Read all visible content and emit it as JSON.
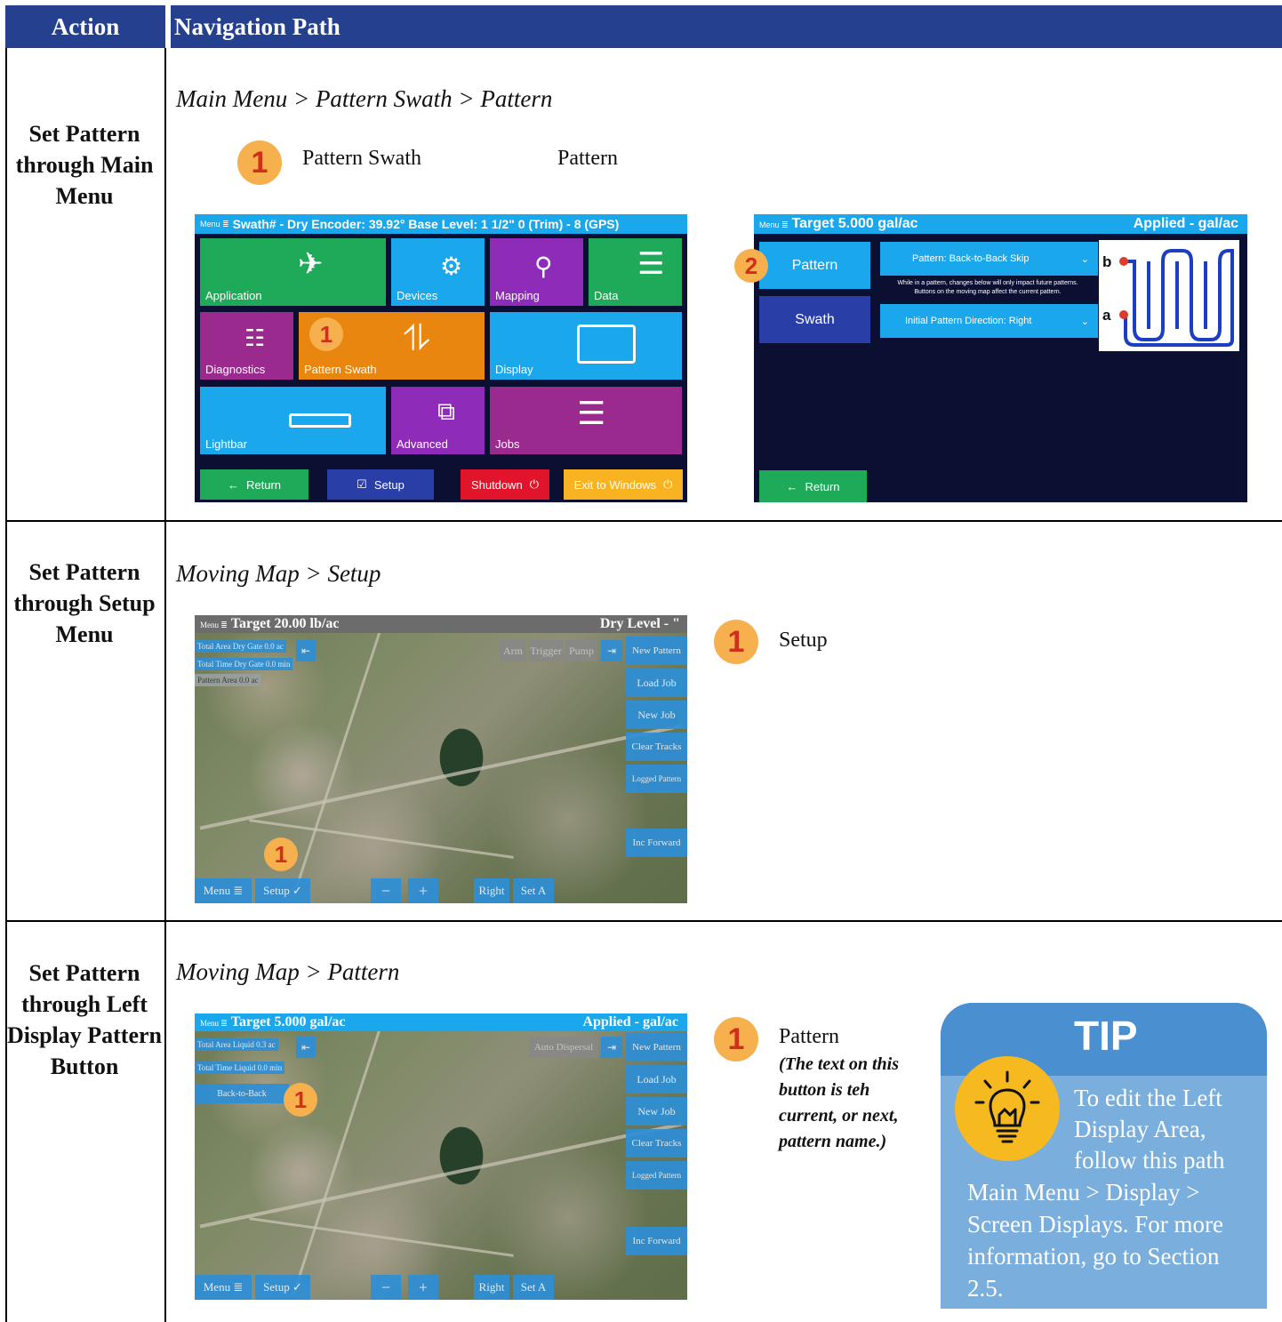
{
  "header": {
    "col_action": "Action",
    "col_path": "Navigation Path"
  },
  "rows": [
    {
      "action": "Set Pattern through Main Menu",
      "path": "Main Menu > Pattern Swath > Pattern",
      "steps": [
        {
          "num": "1",
          "label": "Pattern Swath"
        },
        {
          "num": "",
          "label": "Pattern"
        }
      ]
    },
    {
      "action": "Set Pattern through Setup Menu",
      "path": "Moving Map > Setup",
      "steps": [
        {
          "num": "1",
          "label": "Setup"
        }
      ]
    },
    {
      "action": "Set Pattern through Left Display Pattern Button",
      "path": "Moving Map > Pattern",
      "steps": [
        {
          "num": "1",
          "label": "Pattern",
          "note": "(The text on this button is teh current, or next, pattern name.)"
        }
      ]
    }
  ],
  "main_menu_screen": {
    "menu_label": "Menu",
    "status": "Swath# -   Dry Encoder: 39.92°   Base Level: 1 1/2\"  0 (Trim) - 8 (GPS)",
    "tiles": [
      "Application",
      "Devices",
      "Mapping",
      "Data",
      "Diagnostics",
      "Pattern Swath",
      "Display",
      "Lightbar",
      "Advanced",
      "Jobs"
    ],
    "buttons": [
      "Return",
      "Setup",
      "Shutdown",
      "Exit to Windows"
    ],
    "callout": "1",
    "tile_colors": {
      "green": "#1faa59",
      "blue": "#1aa7ec",
      "purple": "#8e2bb8",
      "magenta": "#9a2a8e",
      "orange": "#e8860f"
    }
  },
  "pattern_screen": {
    "menu_label": "Menu",
    "target": "Target 5.000 gal/ac",
    "applied": "Applied - gal/ac",
    "pattern_button": "Pattern",
    "swath_button": "Swath",
    "pattern_dropdown": "Pattern: Back-to-Back Skip",
    "note_line1": "While in a pattern, changes below will only impact future patterns.",
    "note_line2": "Buttons on the moving map affect the current pattern.",
    "direction_dropdown": "Initial Pattern Direction: Right",
    "diagram_labels": [
      "b",
      "a"
    ],
    "return": "Return",
    "callout": "2"
  },
  "map_setup": {
    "menu_label": "Menu",
    "target": "Target 20.00 lb/ac",
    "right": "Dry Level - \"",
    "overlays": [
      "Total Area Dry Gate 0.0 ac",
      "Total Time Dry Gate 0.0 min",
      "Pattern Area      0.0 ac"
    ],
    "toggles": [
      "Arm",
      "Trigger",
      "Pump"
    ],
    "side_buttons": [
      "New Pattern",
      "Load Job",
      "New Job",
      "Clear Tracks",
      "Logged Pattern",
      "Inc Forward"
    ],
    "bottom_buttons": [
      "Menu",
      "Setup",
      "−",
      "+",
      "Right",
      "Set A"
    ],
    "callout": "1"
  },
  "map_pattern": {
    "menu_label": "Menu",
    "target": "Target 5.000 gal/ac",
    "right": "Applied - gal/ac",
    "overlays": [
      "Total Area Liquid  0.3 ac",
      "Total Time Liquid 0.0 min"
    ],
    "pattern_button": "Back-to-Back",
    "toggles": [
      "Auto Dispersal"
    ],
    "side_buttons": [
      "New Pattern",
      "Load Job",
      "New Job",
      "Clear Tracks",
      "Logged Pattern",
      "Inc Forward"
    ],
    "bottom_buttons": [
      "Menu",
      "Setup",
      "−",
      "+",
      "Right",
      "Set A"
    ],
    "callout": "1"
  },
  "tip": {
    "title": "TIP",
    "line1": "To edit the Left Display Area, follow this path",
    "line2": "Main Menu > Display > Screen Displays. For more information, go to Section 2.5."
  }
}
